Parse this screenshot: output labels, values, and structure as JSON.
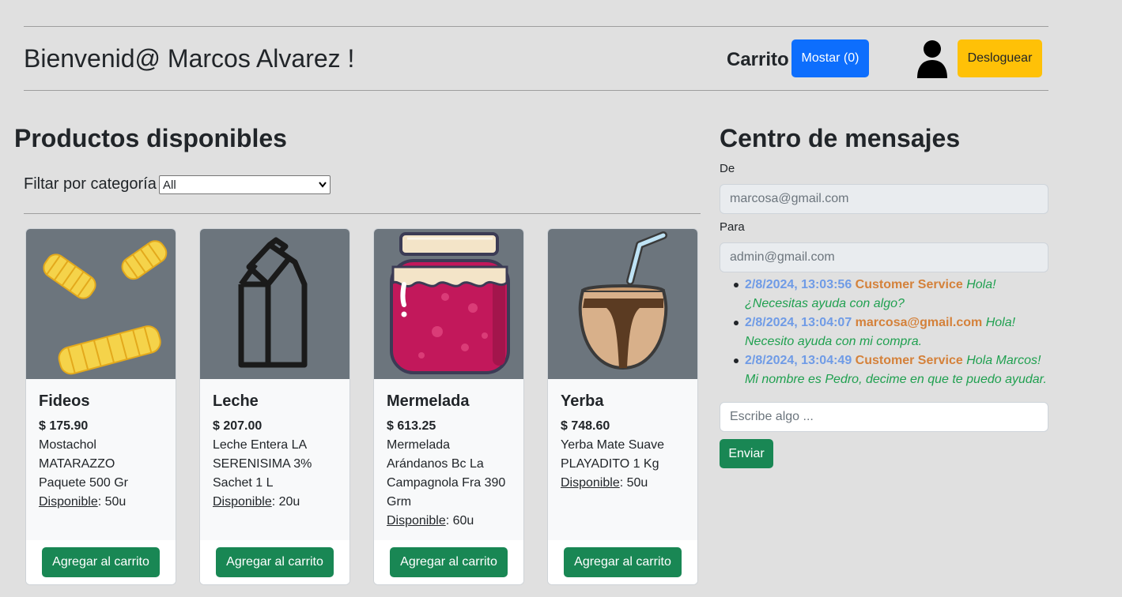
{
  "header": {
    "welcome": "Bienvenid@ Marcos Alvarez !",
    "cart_label": "Carrito",
    "show_button": "Mostar (0)",
    "logout_button": "Desloguear"
  },
  "products": {
    "heading": "Productos disponibles",
    "filter_label": "Filtar por categoría",
    "filter_value": "All",
    "stock_label": "Disponible",
    "add_button": "Agregar al carrito",
    "items": [
      {
        "name": "Fideos",
        "price": "$ 175.90",
        "description": "Mostachol MATARAZZO Paquete 500 Gr",
        "stock": ": 50u",
        "icon": "pasta-icon"
      },
      {
        "name": "Leche",
        "price": "$ 207.00",
        "description": "Leche Entera LA SERENISIMA 3% Sachet 1 L",
        "stock": ": 20u",
        "icon": "milk-carton-icon"
      },
      {
        "name": "Mermelada",
        "price": "$ 613.25",
        "description": "Mermelada Arándanos Bc La Campagnola Fra 390 Grm",
        "stock": ": 60u",
        "icon": "jam-jar-icon"
      },
      {
        "name": "Yerba",
        "price": "$ 748.60",
        "description": "Yerba Mate Suave PLAYADITO 1 Kg",
        "stock": ": 50u",
        "icon": "mate-gourd-icon"
      }
    ]
  },
  "messages": {
    "heading": "Centro de mensajes",
    "from_label": "De",
    "from_value": "marcosa@gmail.com",
    "to_label": "Para",
    "to_value": "admin@gmail.com",
    "list": [
      {
        "date": "2/8/2024, 13:03:56",
        "user": "Customer Service",
        "text": "Hola! ¿Necesitas ayuda con algo?"
      },
      {
        "date": "2/8/2024, 13:04:07",
        "user": "marcosa@gmail.com",
        "text": "Hola! Necesito ayuda con mi compra."
      },
      {
        "date": "2/8/2024, 13:04:49",
        "user": "Customer Service",
        "text": "Hola Marcos! Mi nombre es Pedro, decime en que te puedo ayudar."
      }
    ],
    "input_placeholder": "Escribe algo ...",
    "send_button": "Enviar"
  },
  "colors": {
    "primary": "#0d6efd",
    "warning": "#ffc107",
    "success": "#198754",
    "card_image_bg": "#6c757d",
    "message_date": "#6f9be6",
    "message_user": "#d4813a",
    "message_text": "#20a050"
  }
}
